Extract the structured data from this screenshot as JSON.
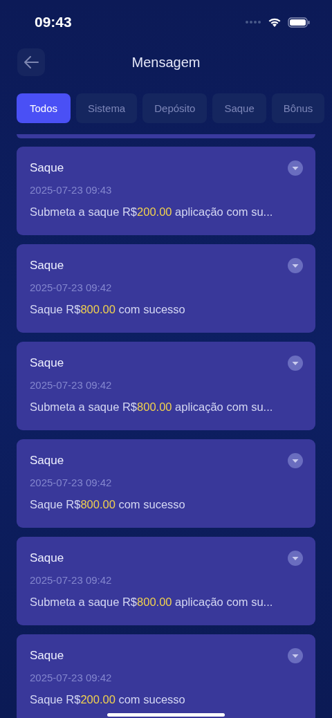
{
  "status_bar": {
    "time": "09:43"
  },
  "header": {
    "title": "Mensagem"
  },
  "tabs": [
    {
      "label": "Todos",
      "selected": true
    },
    {
      "label": "Sistema",
      "selected": false
    },
    {
      "label": "Depósito",
      "selected": false
    },
    {
      "label": "Saque",
      "selected": false
    },
    {
      "label": "Bônus",
      "selected": false
    }
  ],
  "messages": [
    {
      "title": "Saque",
      "date": "2025-07-23 09:43",
      "before": "Submeta a saque R$",
      "amount": "200.00",
      "after": " aplicação com su..."
    },
    {
      "title": "Saque",
      "date": "2025-07-23 09:42",
      "before": "Saque R$",
      "amount": "800.00",
      "after": " com sucesso"
    },
    {
      "title": "Saque",
      "date": "2025-07-23 09:42",
      "before": "Submeta a saque R$",
      "amount": "800.00",
      "after": " aplicação com su..."
    },
    {
      "title": "Saque",
      "date": "2025-07-23 09:42",
      "before": "Saque R$",
      "amount": "800.00",
      "after": " com sucesso"
    },
    {
      "title": "Saque",
      "date": "2025-07-23 09:42",
      "before": "Submeta a saque R$",
      "amount": "800.00",
      "after": " aplicação com su..."
    },
    {
      "title": "Saque",
      "date": "2025-07-23 09:42",
      "before": "Saque R$",
      "amount": "200.00",
      "after": " com sucesso"
    }
  ]
}
